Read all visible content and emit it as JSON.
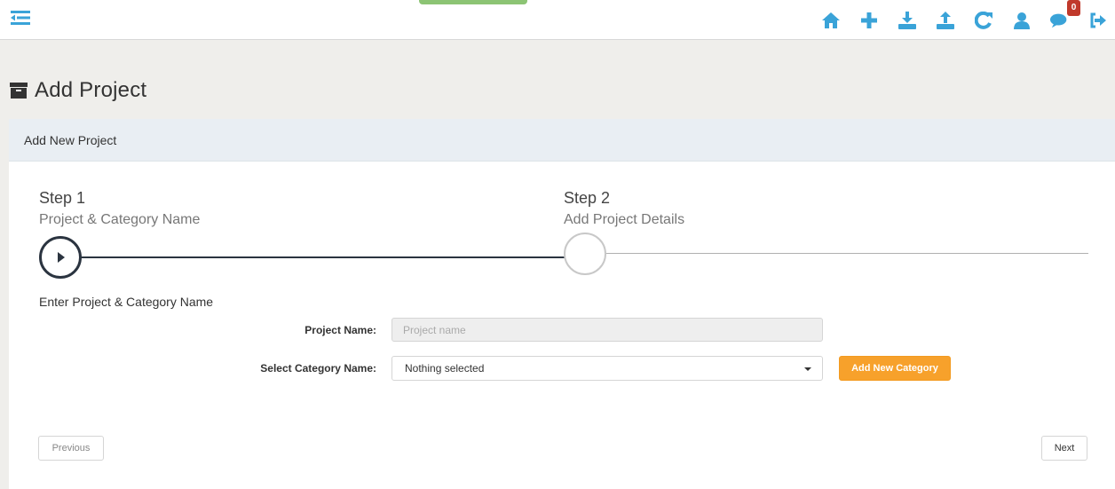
{
  "toolbar": {
    "icons": [
      "home-icon",
      "plus-icon",
      "download-icon",
      "upload-icon",
      "refresh-icon",
      "user-icon",
      "chat-icon",
      "logout-icon"
    ],
    "notification_count": "0",
    "accent_color": "#3aa3d8"
  },
  "page": {
    "title": "Add Project"
  },
  "panel": {
    "heading": "Add New Project"
  },
  "steps": [
    {
      "title": "Step 1",
      "subtitle": "Project & Category Name"
    },
    {
      "title": "Step 2",
      "subtitle": "Add Project Details"
    }
  ],
  "form": {
    "section_label": "Enter Project & Category Name",
    "project_name_label": "Project Name:",
    "project_name_placeholder": "Project name",
    "project_name_value": "",
    "category_label": "Select Category Name:",
    "category_selected": "Nothing selected",
    "add_category_label": "Add New Category"
  },
  "nav": {
    "previous_label": "Previous",
    "next_label": "Next"
  }
}
